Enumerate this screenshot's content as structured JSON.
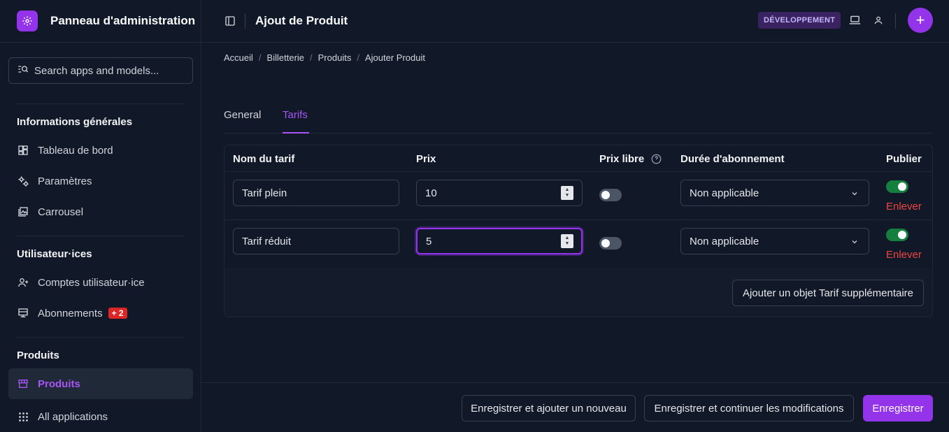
{
  "brand": {
    "title": "Panneau d'administration",
    "logo_icon": "gear-icon"
  },
  "search": {
    "placeholder": "Search apps and models..."
  },
  "sidebar": {
    "sections": [
      {
        "title": "Informations générales",
        "items": [
          {
            "label": "Tableau de bord",
            "icon": "dashboard-icon"
          },
          {
            "label": "Paramètres",
            "icon": "settings-icon"
          },
          {
            "label": "Carrousel",
            "icon": "carousel-icon"
          }
        ]
      },
      {
        "title": "Utilisateur·ices",
        "items": [
          {
            "label": "Comptes utilisateur·ice",
            "icon": "user-plus-icon"
          },
          {
            "label": "Abonnements",
            "icon": "subscription-icon",
            "badge": "+ 2"
          }
        ]
      },
      {
        "title": "Produits",
        "items": [
          {
            "label": "Produits",
            "icon": "storefront-icon",
            "active": true
          },
          {
            "label": "All applications",
            "icon": "apps-grid-icon"
          }
        ]
      }
    ]
  },
  "header": {
    "title": "Ajout de Produit",
    "env_badge": "DÉVELOPPEMENT",
    "toggle_icon": "sidebar-toggle-icon",
    "laptop_icon": "laptop-icon",
    "user_icon": "user-icon",
    "plus_label": "+"
  },
  "breadcrumb": [
    "Accueil",
    "Billetterie",
    "Produits",
    "Ajouter Produit"
  ],
  "breadcrumb_sep": "/",
  "tabs": [
    {
      "label": "General",
      "active": false
    },
    {
      "label": "Tarifs",
      "active": true
    }
  ],
  "table": {
    "columns": {
      "name": "Nom du tarif",
      "price": "Prix",
      "free_price": "Prix libre",
      "duration": "Durée d'abonnement",
      "publish": "Publier"
    },
    "rows": [
      {
        "name": "Tarif plein",
        "price": "10",
        "free_price": false,
        "duration": "Non applicable",
        "publish": true,
        "remove": "Enlever"
      },
      {
        "name": "Tarif réduit",
        "price": "5",
        "free_price": false,
        "duration": "Non applicable",
        "publish": true,
        "remove": "Enlever"
      }
    ],
    "add_button": "Ajouter un objet Tarif supplémentaire"
  },
  "footer": {
    "save_add": "Enregistrer et ajouter un nouveau",
    "save_continue": "Enregistrer et continuer les modifications",
    "save": "Enregistrer"
  },
  "colors": {
    "accent": "#9333ea",
    "danger": "#ef4444",
    "success": "#15803d"
  }
}
